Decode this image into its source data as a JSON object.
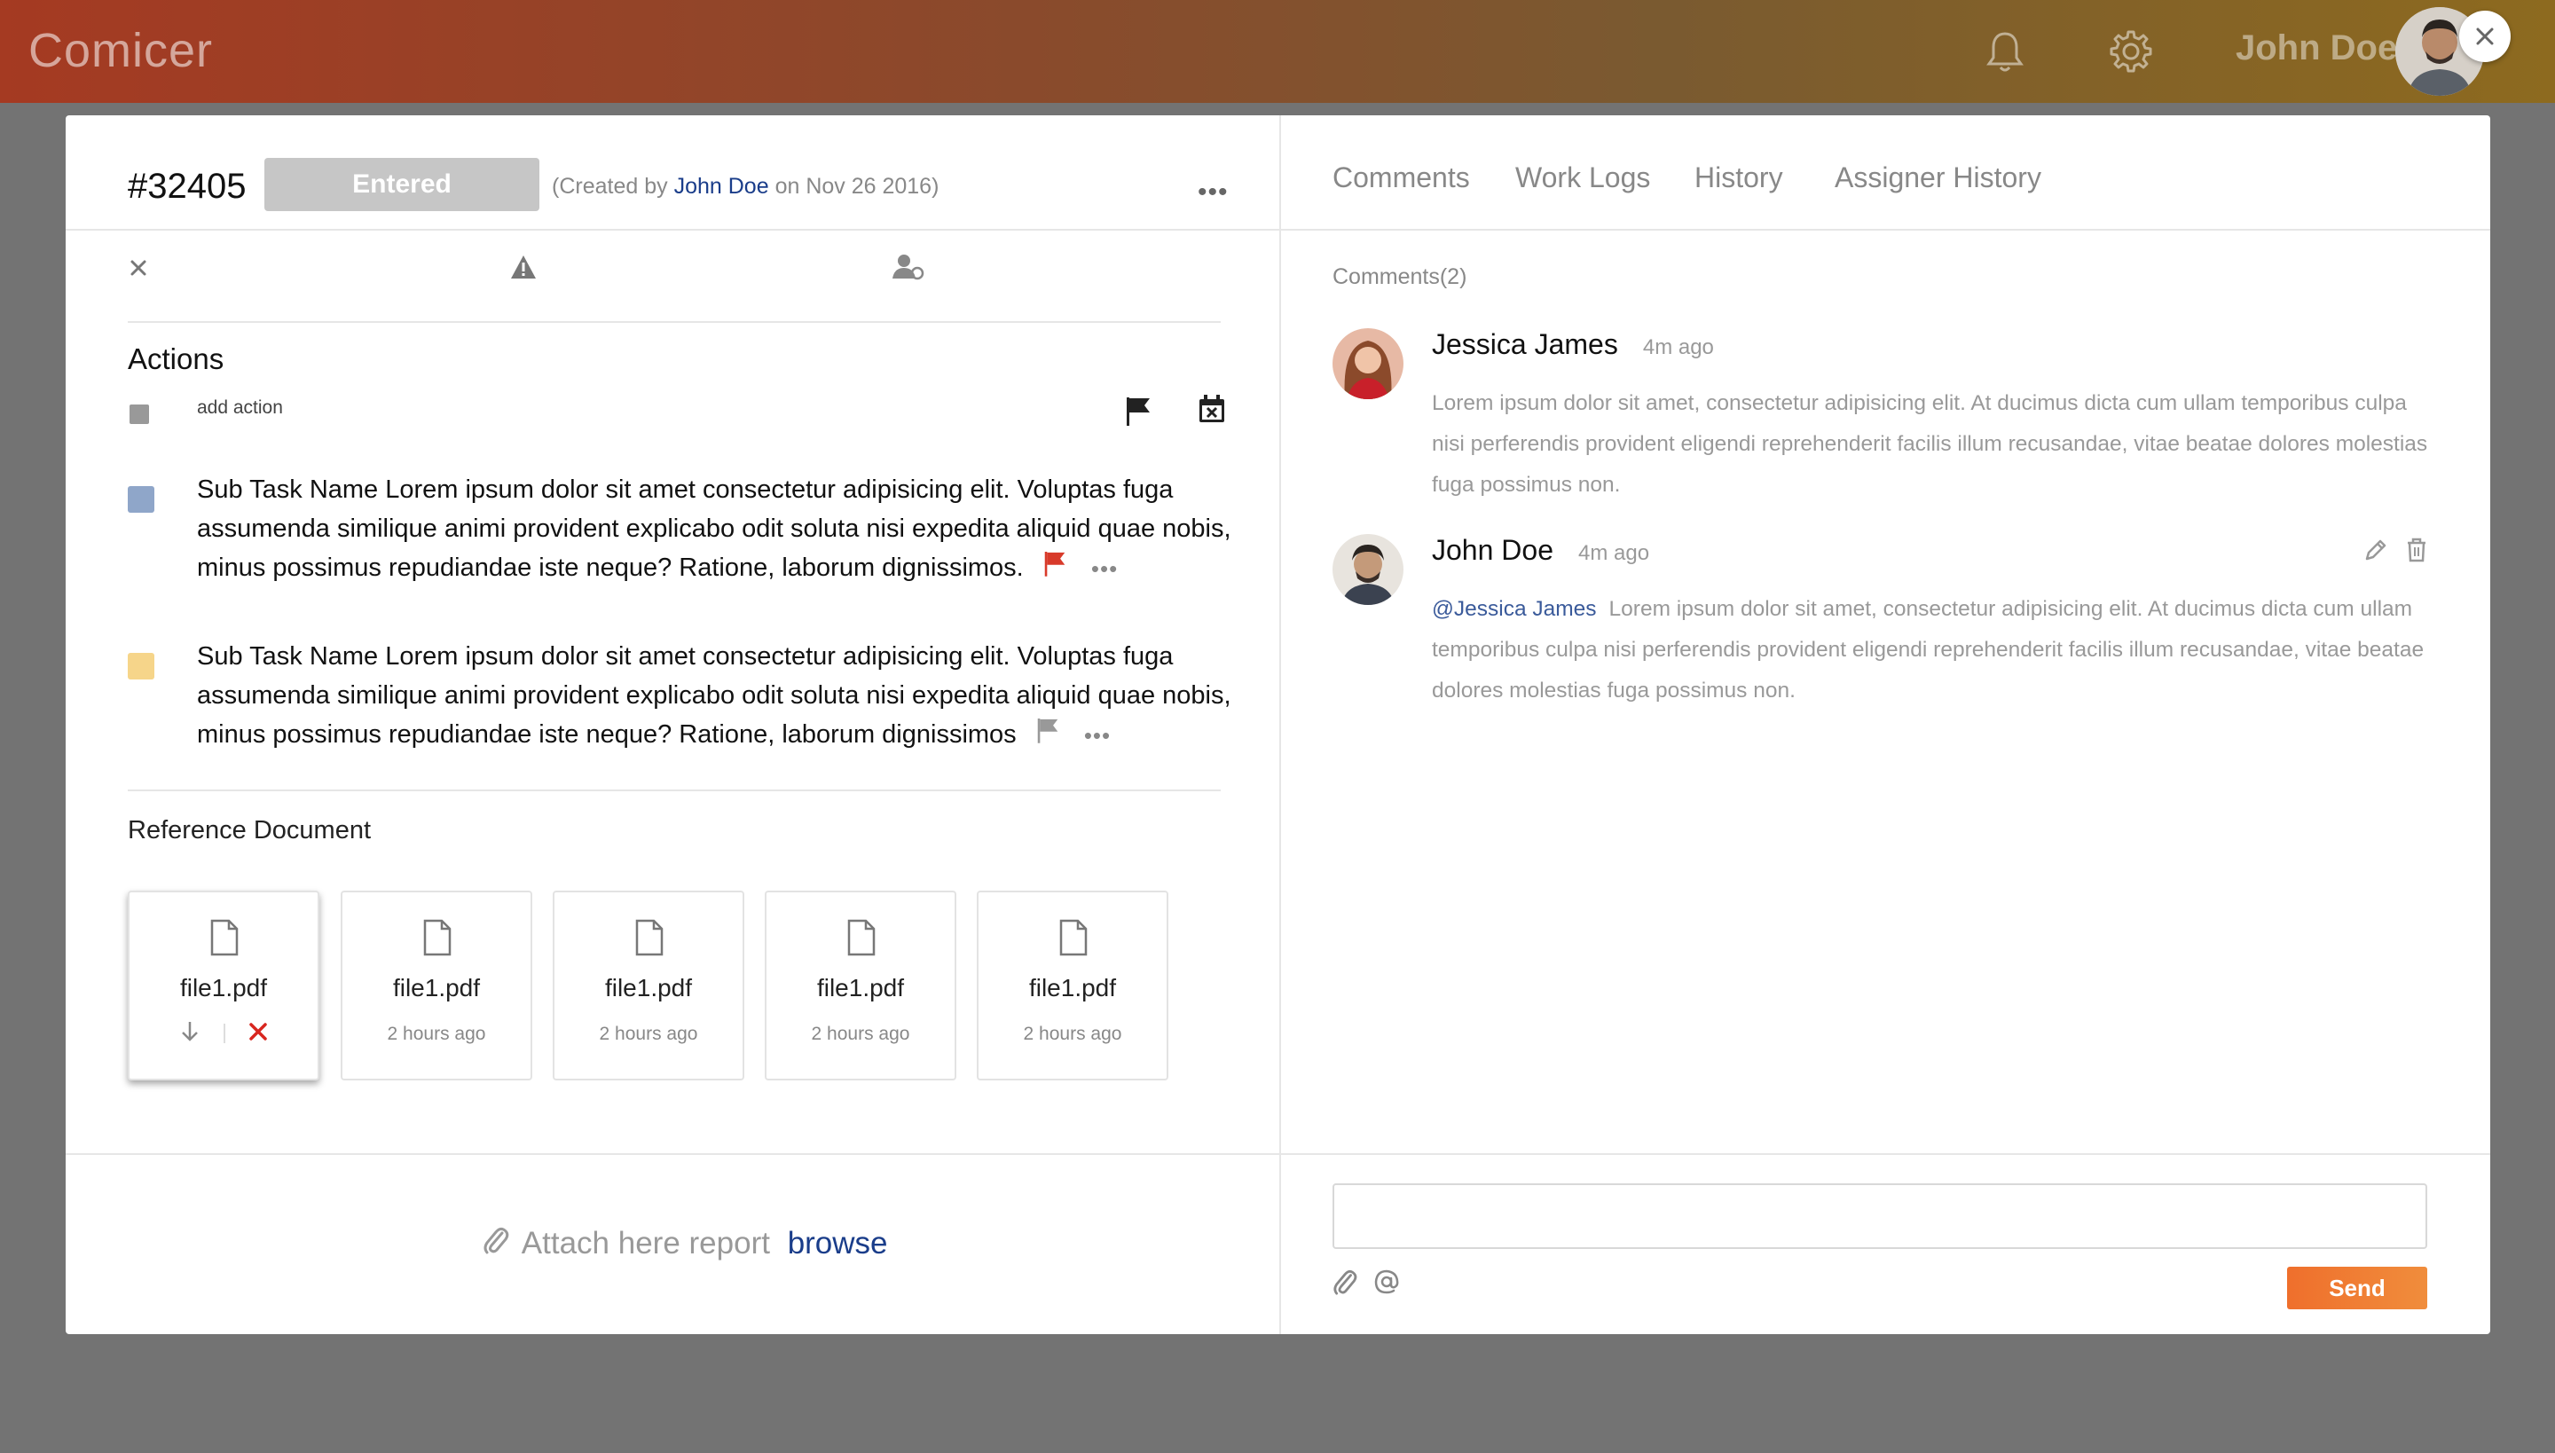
{
  "app": {
    "name": "Comicer"
  },
  "topbar": {
    "user_name": "John Doe"
  },
  "ticket": {
    "id": "#32405",
    "status": "Entered",
    "created_prefix": "(Created by",
    "created_author": "John Doe",
    "created_suffix": "on Nov 26 2016)"
  },
  "actions": {
    "title": "Actions",
    "add_label": "add action",
    "tasks": [
      {
        "text": "Sub Task Name Lorem ipsum dolor sit amet consectetur adipisicing elit. Voluptas fuga assumenda similique animi provident explicabo odit soluta nisi expedita aliquid quae nobis, minus possimus repudiandae iste neque? Ratione, laborum dignissimos.",
        "color": "#8fa6c9",
        "flag_color": "#d83a2a"
      },
      {
        "text": "Sub Task Name Lorem ipsum dolor sit amet consectetur adipisicing elit. Voluptas fuga assumenda similique animi provident explicabo odit soluta nisi expedita aliquid quae nobis, minus possimus repudiandae iste neque? Ratione, laborum dignissimos",
        "color": "#f6d58a",
        "flag_color": "#999999"
      }
    ]
  },
  "reference": {
    "title": "Reference Document",
    "files": [
      {
        "name": "file1.pdf",
        "meta": ""
      },
      {
        "name": "file1.pdf",
        "meta": "2 hours ago"
      },
      {
        "name": "file1.pdf",
        "meta": "2 hours ago"
      },
      {
        "name": "file1.pdf",
        "meta": "2 hours ago"
      },
      {
        "name": "file1.pdf",
        "meta": "2 hours ago"
      }
    ]
  },
  "attach": {
    "label": "Attach here report",
    "browse": "browse"
  },
  "tabs": [
    "Comments",
    "Work Logs",
    "History",
    "Assigner History"
  ],
  "comments": {
    "count_label": "Comments(2)",
    "items": [
      {
        "author": "Jessica James",
        "time": "4m ago",
        "mention": "",
        "body": "Lorem ipsum dolor sit amet, consectetur adipisicing elit. At ducimus dicta cum ullam temporibus culpa nisi perferendis provident eligendi reprehenderit facilis illum recusandae, vitae beatae dolores molestias fuga possimus non."
      },
      {
        "author": "John Doe",
        "time": "4m ago",
        "mention": "@Jessica James",
        "body": "Lorem ipsum dolor sit amet, consectetur adipisicing elit. At ducimus dicta cum ullam temporibus culpa nisi perferendis provident eligendi reprehenderit facilis illum recusandae, vitae beatae dolores molestias fuga possimus non."
      }
    ]
  },
  "composer": {
    "placeholder": "",
    "send_label": "Send"
  },
  "colors": {
    "accent_orange": "#ef6f2c",
    "link_blue": "#1a3d8a",
    "flag_red": "#d83a2a"
  }
}
